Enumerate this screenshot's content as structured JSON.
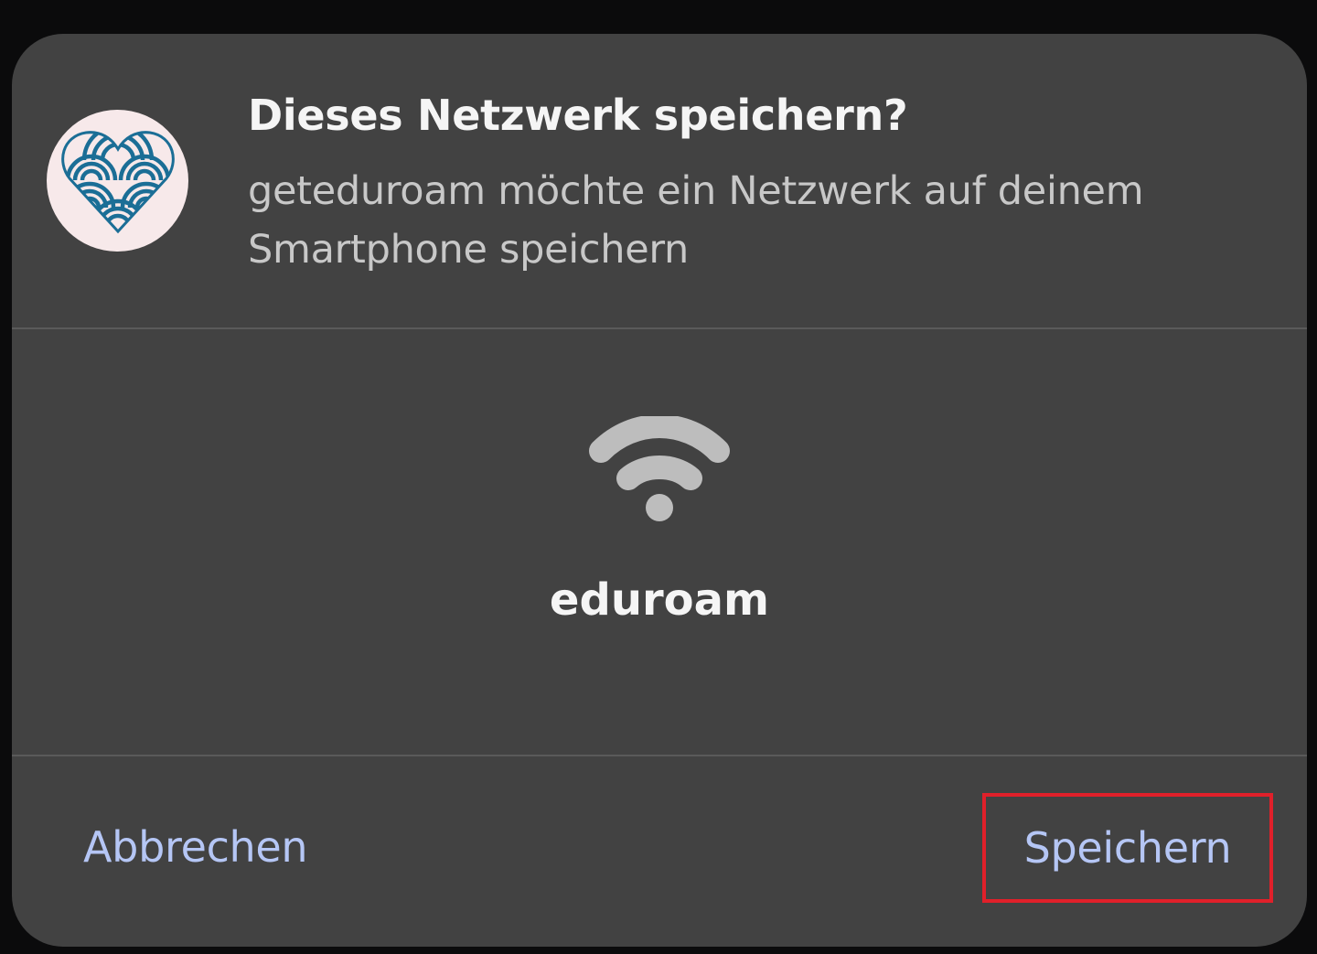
{
  "dialog": {
    "title": "Dieses Netzwerk speichern?",
    "subtitle": "geteduroam möchte ein Netzwerk auf deinem Smartphone speichern",
    "app_icon": "geteduroam-heart-icon",
    "network": {
      "icon": "wifi-icon",
      "name": "eduroam"
    },
    "actions": {
      "cancel_label": "Abbrechen",
      "save_label": "Speichern"
    }
  },
  "colors": {
    "backdrop": "#0b0b0c",
    "surface": "#424242",
    "title_text": "#f5f5f5",
    "subtitle_text": "#c8c8c8",
    "accent": "#b5c6f5",
    "icon_bg": "#f7e9ea",
    "icon_blue": "#1b6e96",
    "wifi_gray": "#bdbdbd",
    "highlight_box": "#e0202a"
  }
}
